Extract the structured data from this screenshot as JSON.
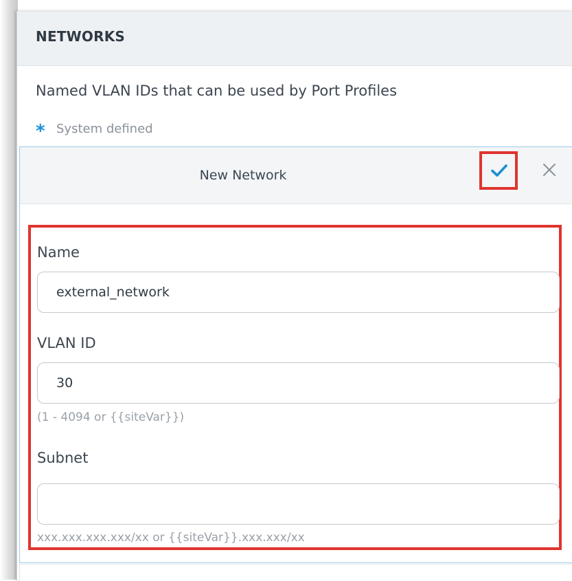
{
  "panel": {
    "title": "NETWORKS",
    "description": "Named VLAN IDs that can be used by Port Profiles",
    "legend": {
      "icon": "asterisk-icon",
      "text": "System defined",
      "color": "#1a8fd6"
    }
  },
  "form": {
    "title": "New Network",
    "confirm_icon": "checkmark-icon",
    "close_icon": "close-icon",
    "highlight_color": "#e0342f",
    "fields": {
      "name": {
        "label": "Name",
        "value": "external_network"
      },
      "vlan": {
        "label": "VLAN ID",
        "value": "30",
        "hint": "(1 - 4094 or {{siteVar}})"
      },
      "subnet": {
        "label": "Subnet",
        "value": "",
        "hint": "xxx.xxx.xxx.xxx/xx or {{siteVar}}.xxx.xxx/xx"
      }
    }
  }
}
